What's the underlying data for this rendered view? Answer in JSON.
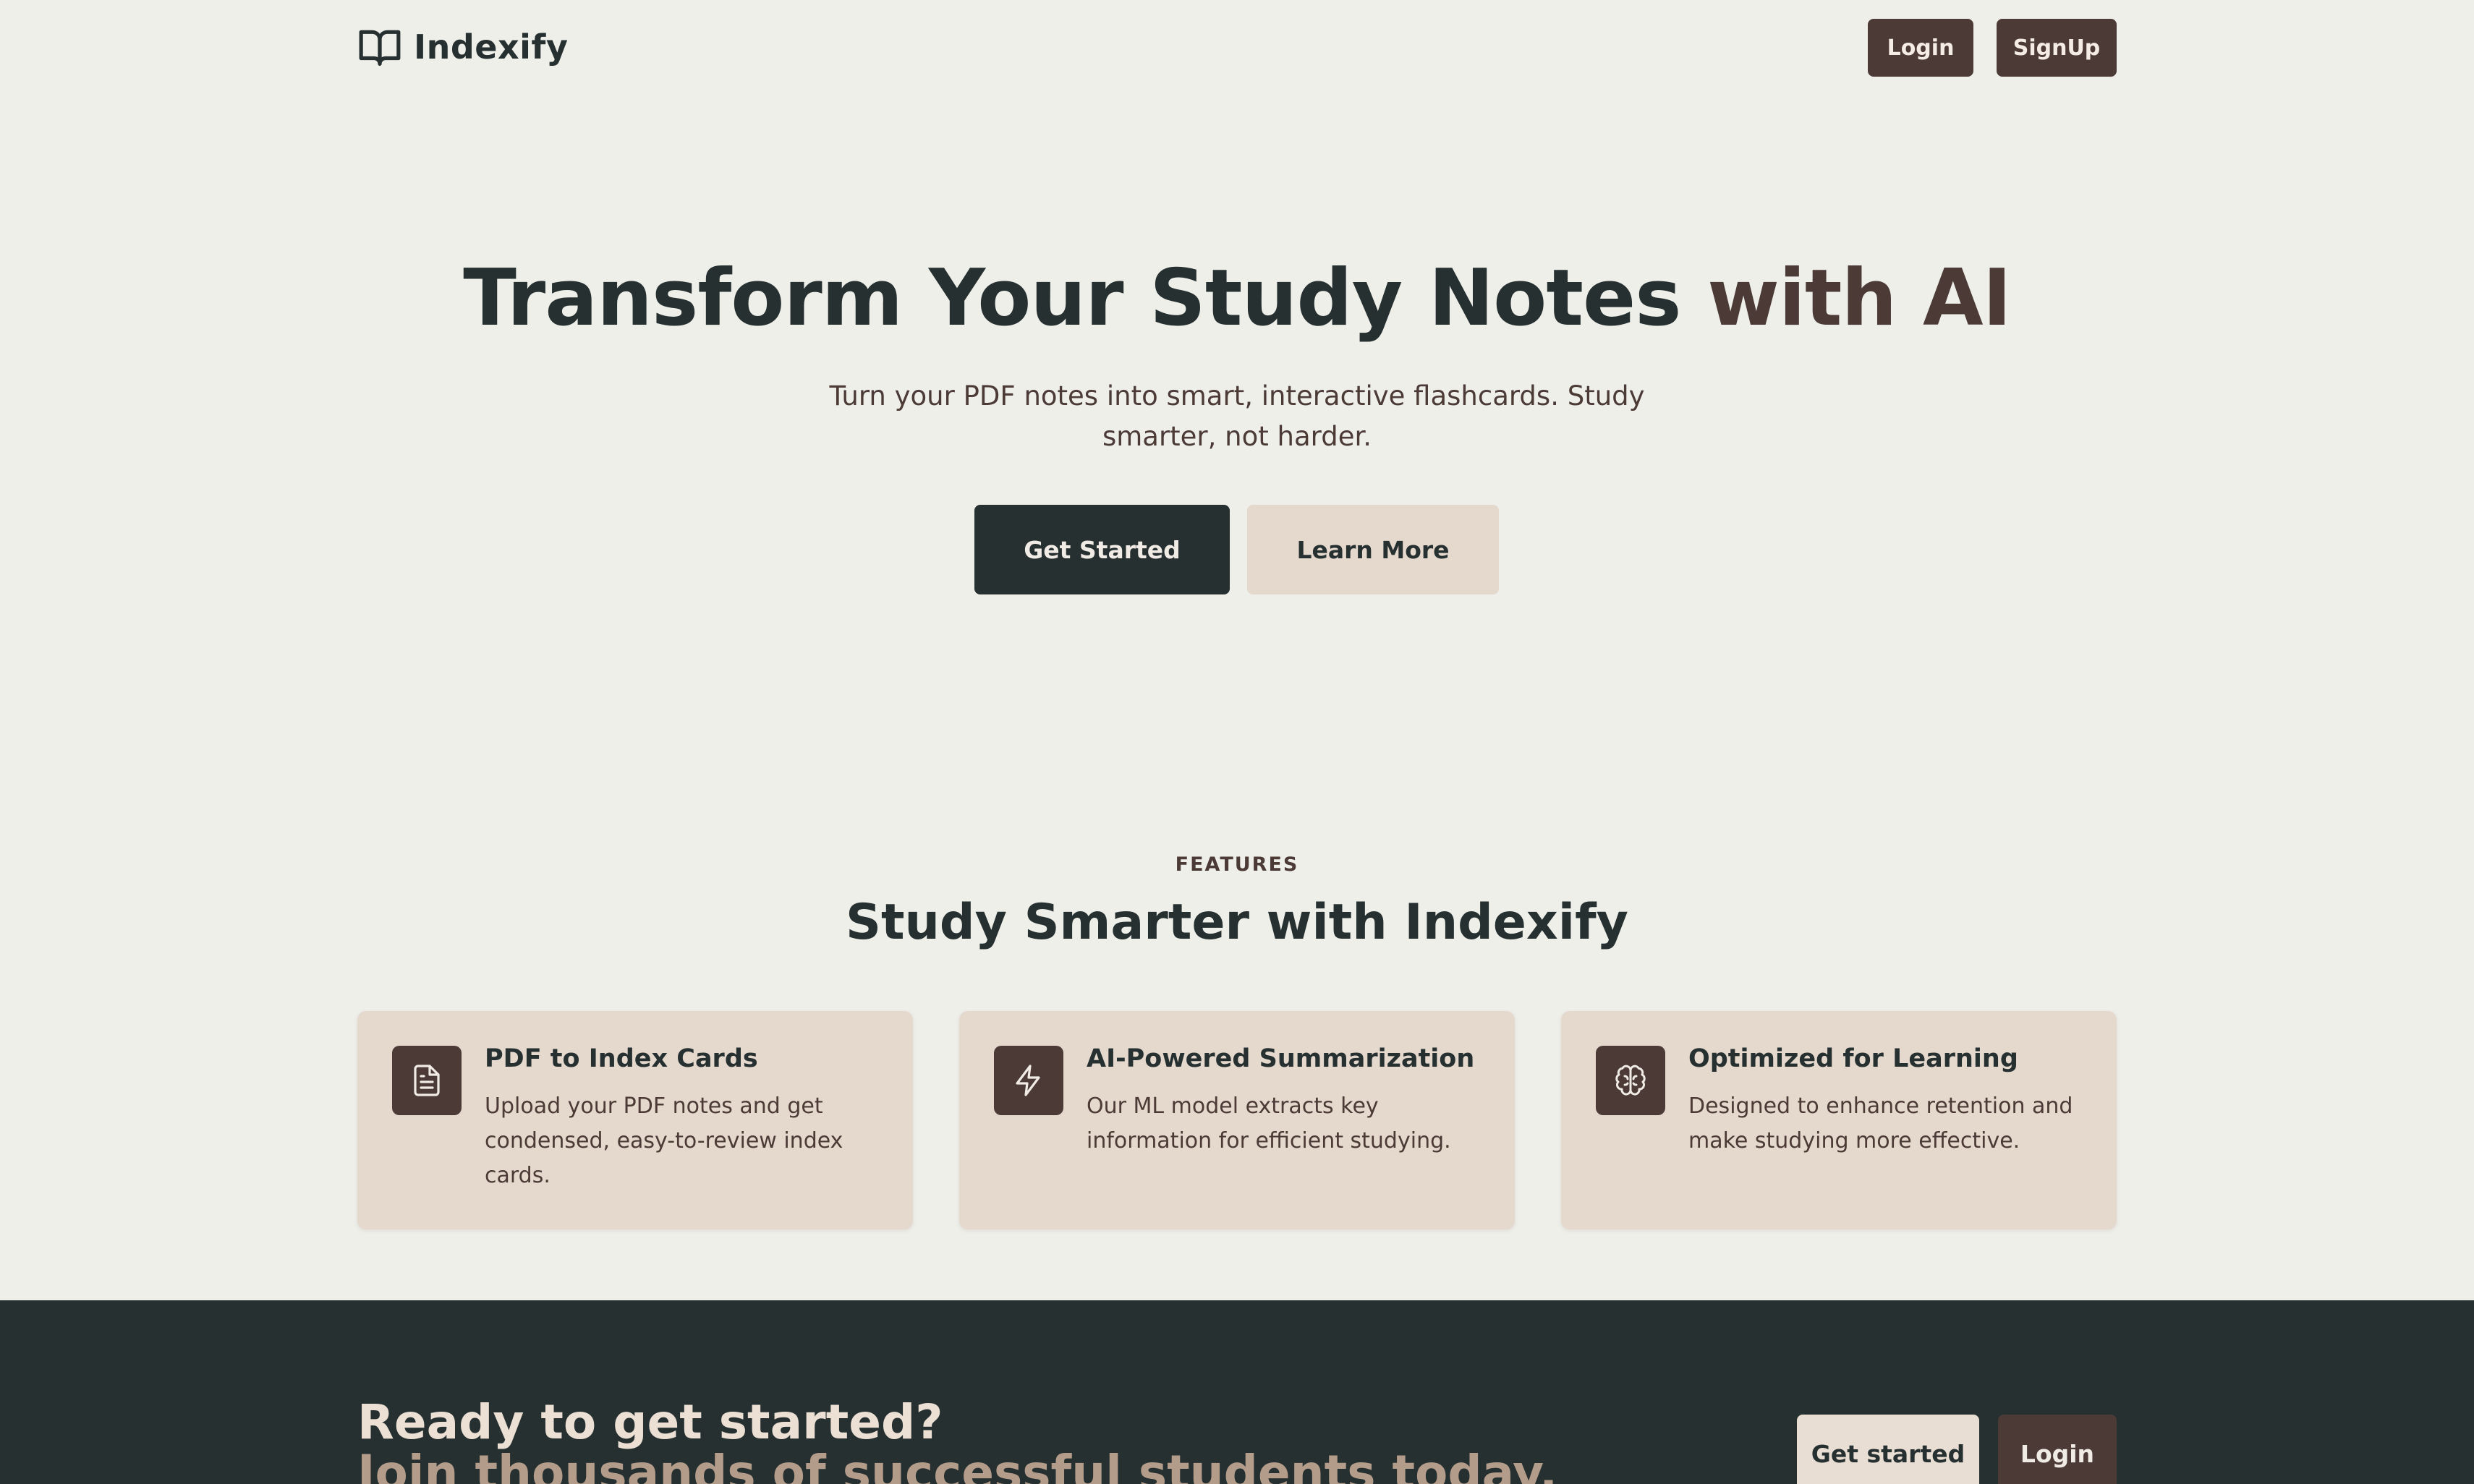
{
  "app": {
    "name": "Indexify",
    "logo_icon": "open-book-icon"
  },
  "colors": {
    "background": "#efefea",
    "dark": "#263031",
    "brown": "#4b3a35",
    "beige": "#e5d9ce"
  },
  "nav": {
    "login_label": "Login",
    "signup_label": "SignUp"
  },
  "hero": {
    "title_main": "Transform Your Study Notes ",
    "title_accent": "with AI",
    "subtitle": "Turn your PDF notes into smart, interactive flashcards. Study smarter, not harder.",
    "primary_button": "Get Started",
    "secondary_button": "Learn More"
  },
  "features": {
    "eyebrow": "FEATURES",
    "title": "Study Smarter with Indexify",
    "items": [
      {
        "icon": "document-icon",
        "title": "PDF to Index Cards",
        "description": "Upload your PDF notes and get condensed, easy-to-review index cards."
      },
      {
        "icon": "lightning-icon",
        "title": "AI-Powered Summarization",
        "description": "Our ML model extracts key information for efficient studying."
      },
      {
        "icon": "brain-icon",
        "title": "Optimized for Learning",
        "description": "Designed to enhance retention and make studying more effective."
      }
    ]
  },
  "cta": {
    "title": "Ready to get started?",
    "subtitle": "Join thousands of successful students today.",
    "start_button": "Get started",
    "login_button": "Login"
  }
}
